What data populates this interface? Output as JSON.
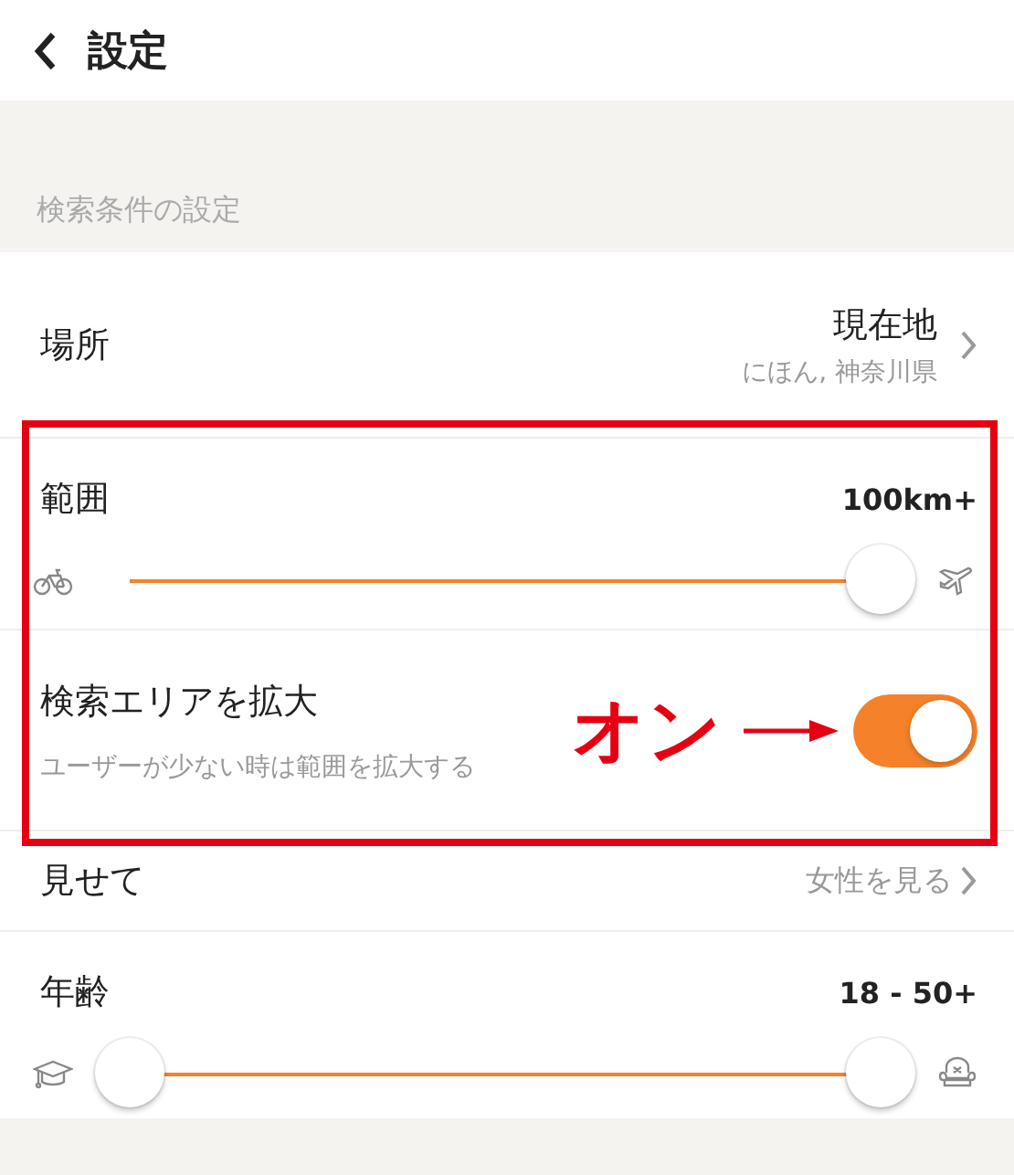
{
  "header": {
    "title": "設定"
  },
  "section_label": "検索条件の設定",
  "location": {
    "label": "場所",
    "value": "現在地",
    "detail": "にほん, 神奈川県"
  },
  "range": {
    "label": "範囲",
    "reading": "100km+",
    "level": 1
  },
  "expand": {
    "label": "検索エリアを拡大",
    "hint": "ユーザーが少ない時は範囲を拡大する",
    "on": true
  },
  "show": {
    "label": "見せて",
    "value": "女性を見る"
  },
  "age": {
    "label": "年齢",
    "reading": "18 - 50+",
    "thumbs": [
      {
        "level": 0
      },
      {
        "level": 1
      }
    ]
  },
  "annotation": {
    "label": "オン"
  }
}
